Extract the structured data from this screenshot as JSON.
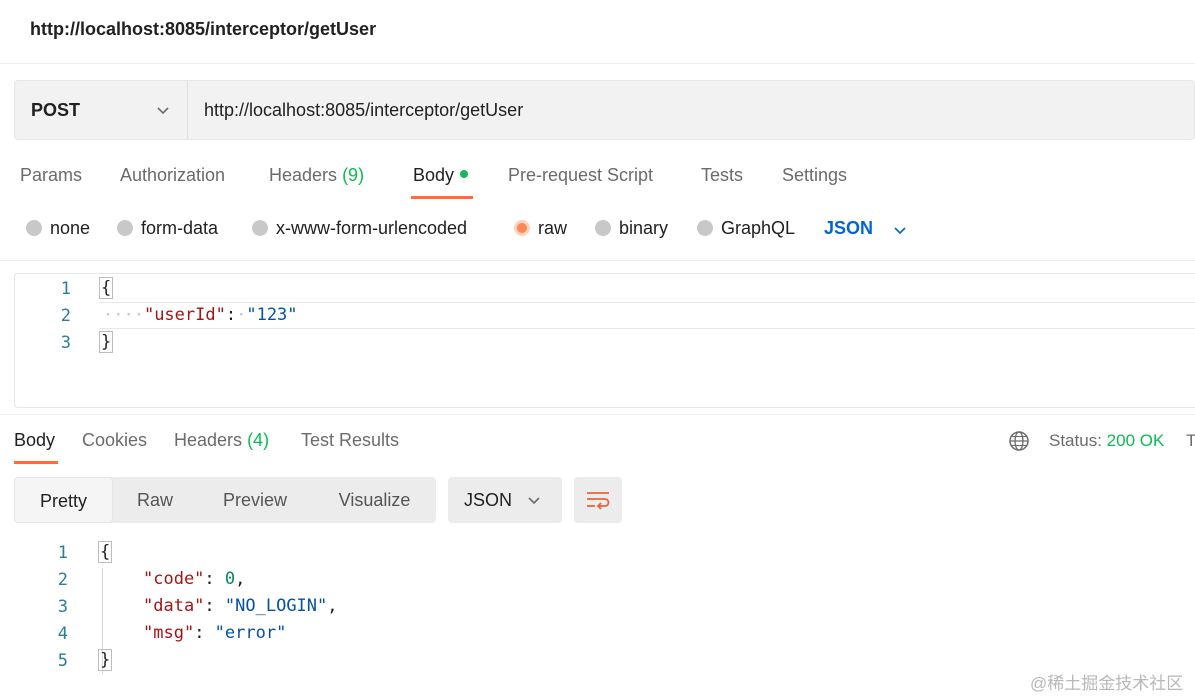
{
  "window": {
    "title": "http://localhost:8085/interceptor/getUser"
  },
  "request": {
    "method": "POST",
    "url": "http://localhost:8085/interceptor/getUser",
    "tabs": [
      {
        "label": "Params"
      },
      {
        "label": "Authorization"
      },
      {
        "label": "Headers",
        "count": "(9)"
      },
      {
        "label": "Body"
      },
      {
        "label": "Pre-request Script"
      },
      {
        "label": "Tests"
      },
      {
        "label": "Settings"
      }
    ],
    "active_tab": "Body",
    "body_types": [
      "none",
      "form-data",
      "x-www-form-urlencoded",
      "raw",
      "binary",
      "GraphQL"
    ],
    "selected_body_type": "raw",
    "raw_format": "JSON",
    "editor": {
      "line_numbers": [
        "1",
        "2",
        "3"
      ],
      "open_brace": "{",
      "close_brace": "}",
      "indent_dots": "····",
      "key": "\"userId\"",
      "colon": ":",
      "sep_dot": "·",
      "value": "\"123\""
    }
  },
  "response": {
    "tabs": [
      {
        "label": "Body"
      },
      {
        "label": "Cookies"
      },
      {
        "label": "Headers",
        "count": "(4)"
      },
      {
        "label": "Test Results"
      }
    ],
    "active_tab": "Body",
    "status_label": "Status:",
    "status_value": "200 OK",
    "cut_text": "T",
    "view_modes": [
      "Pretty",
      "Raw",
      "Preview",
      "Visualize"
    ],
    "active_view": "Pretty",
    "format": "JSON",
    "editor": {
      "line_numbers": [
        "1",
        "2",
        "3",
        "4",
        "5"
      ],
      "open_brace": "{",
      "close_brace": "}",
      "code_key": "\"code\"",
      "code_value": "0",
      "data_key": "\"data\"",
      "data_value": "\"NO_LOGIN\"",
      "msg_key": "\"msg\"",
      "msg_value": "\"error\"",
      "colon": ": ",
      "comma": ","
    }
  },
  "watermark": "@稀土掘金技术社区",
  "colors": {
    "accent": "#ff6c37",
    "success": "#0cbb52",
    "link": "#0265d2"
  },
  "icons": [
    "chevron-down-icon",
    "globe-icon",
    "wrap-lines-icon"
  ]
}
